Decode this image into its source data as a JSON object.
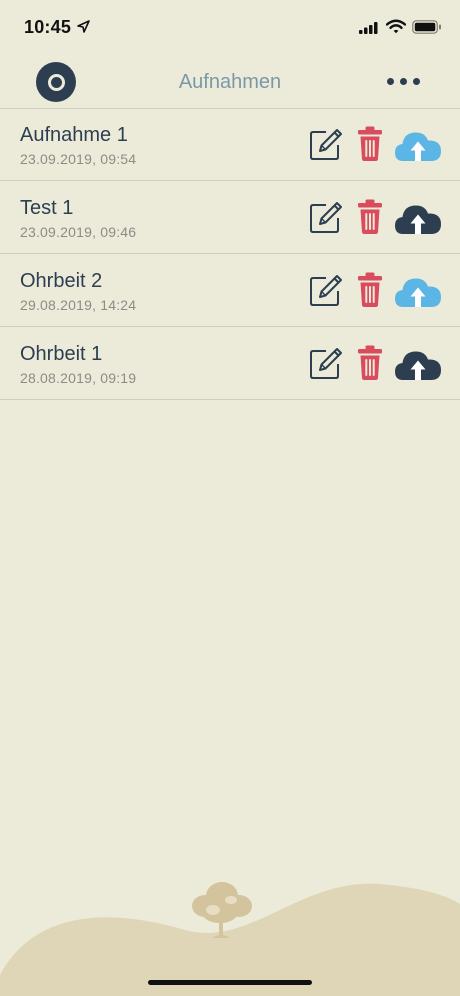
{
  "status": {
    "time": "10:45",
    "icons": [
      "location-arrow-icon",
      "signal-icon",
      "wifi-icon",
      "battery-icon"
    ]
  },
  "nav": {
    "title": "Aufnahmen",
    "left_icon": "record-icon",
    "right_icon": "more-icon"
  },
  "colors": {
    "background": "#ecead9",
    "primary": "#2c3e50",
    "title": "#7a99a8",
    "delete": "#d94c5e",
    "uploaded": "#5bb6e6",
    "not_uploaded": "#2c3e50",
    "hill": "#dfd5b7"
  },
  "recordings": [
    {
      "title": "Aufnahme 1",
      "date": "23.09.2019, 09:54",
      "uploaded": true
    },
    {
      "title": "Test 1",
      "date": "23.09.2019, 09:46",
      "uploaded": false
    },
    {
      "title": "Ohrbeit 2",
      "date": "29.08.2019, 14:24",
      "uploaded": true
    },
    {
      "title": "Ohrbeit 1",
      "date": "28.08.2019, 09:19",
      "uploaded": false
    }
  ]
}
